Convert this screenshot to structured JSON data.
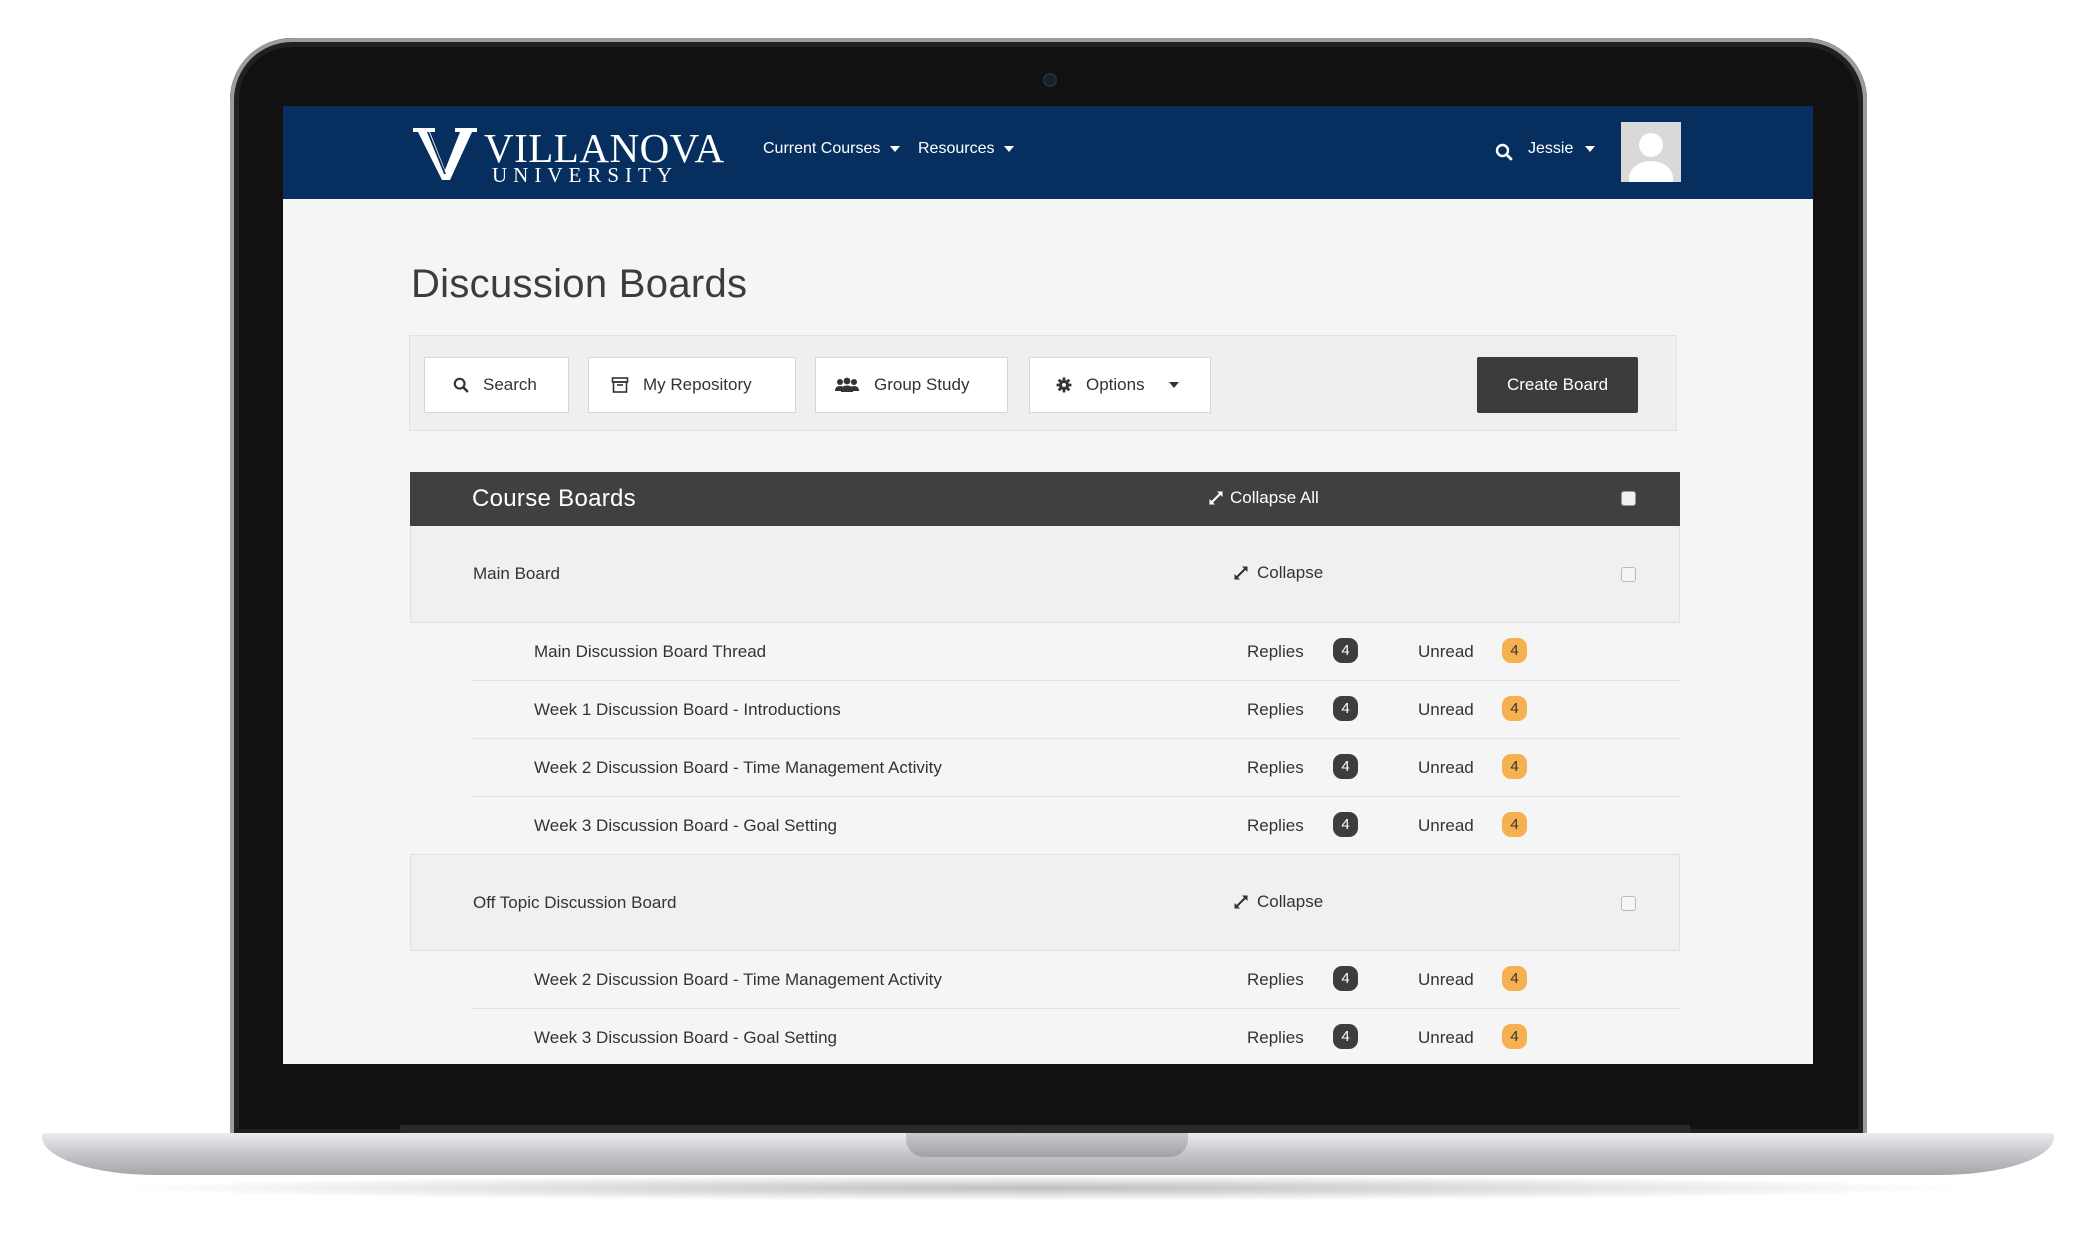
{
  "navbar": {
    "logo_name": "VILLANOVA",
    "logo_sub": "UNIVERSITY",
    "menu": [
      {
        "label": "Current Courses"
      },
      {
        "label": "Resources"
      }
    ],
    "user_name": "Jessie",
    "brand_color": "#062f5f"
  },
  "page": {
    "title": "Discussion Boards"
  },
  "toolbar": {
    "search_label": "Search",
    "repository_label": "My Repository",
    "group_study_label": "Group Study",
    "options_label": "Options",
    "create_label": "Create Board"
  },
  "boards": {
    "title": "Course Boards",
    "collapse_all_label": "Collapse All",
    "replies_label": "Replies",
    "unread_label": "Unread",
    "badge_colors": {
      "replies": "#3d3d3d",
      "unread": "#f5b050"
    },
    "groups": [
      {
        "name": "Main Board",
        "collapse_label": "Collapse",
        "threads": [
          {
            "title": "Main Discussion Board Thread",
            "replies": "4",
            "unread": "4"
          },
          {
            "title": "Week 1 Discussion Board - Introductions",
            "replies": "4",
            "unread": "4"
          },
          {
            "title": "Week 2 Discussion Board - Time Management Activity",
            "replies": "4",
            "unread": "4"
          },
          {
            "title": "Week 3 Discussion Board - Goal Setting",
            "replies": "4",
            "unread": "4"
          }
        ]
      },
      {
        "name": "Off Topic Discussion Board",
        "collapse_label": "Collapse",
        "threads": [
          {
            "title": "Week 2 Discussion Board - Time Management Activity",
            "replies": "4",
            "unread": "4"
          },
          {
            "title": "Week 3 Discussion Board - Goal Setting",
            "replies": "4",
            "unread": "4"
          }
        ]
      }
    ]
  }
}
